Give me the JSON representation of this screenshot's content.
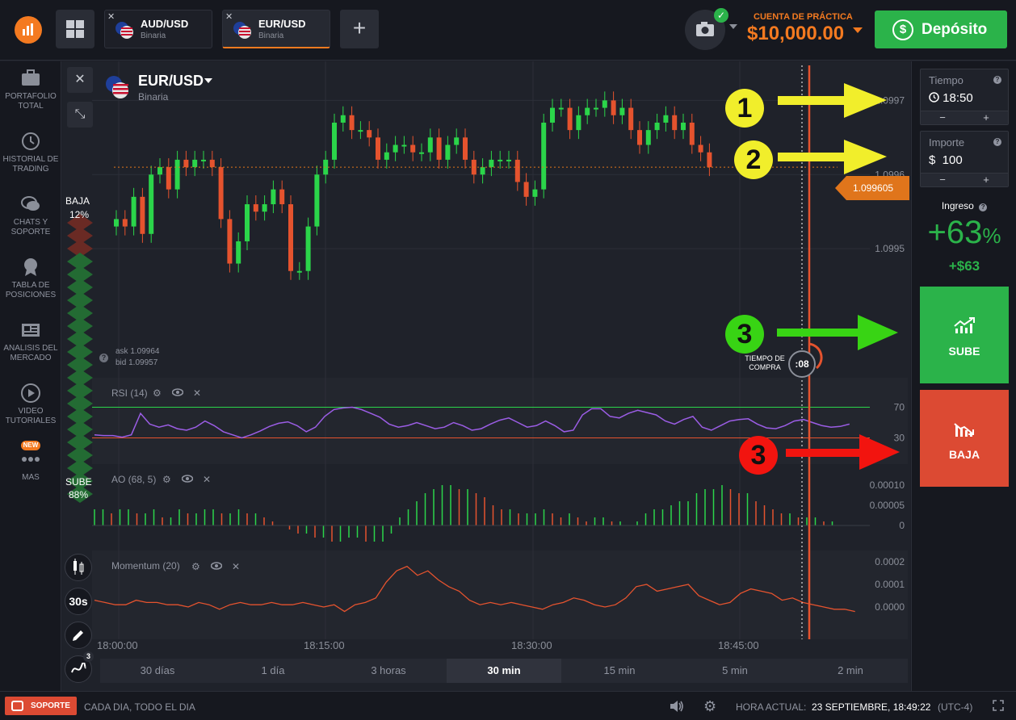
{
  "header": {
    "tabs": [
      {
        "pair": "AUD/USD",
        "type": "Binaria",
        "active": false
      },
      {
        "pair": "EUR/USD",
        "type": "Binaria",
        "active": true
      }
    ],
    "add_tab_label": "+",
    "account_label": "CUENTA DE PRÁCTICA",
    "balance": "$10,000.00",
    "deposit_label": "Depósito",
    "deposit_icon": "$",
    "close_tab_glyph": "✕",
    "camera_check": "✓"
  },
  "sidebar": {
    "items": [
      {
        "label": "PORTAFOLIO TOTAL",
        "icon": "briefcase-icon"
      },
      {
        "label": "HISTORIAL DE TRADING",
        "icon": "history-icon"
      },
      {
        "label": "CHATS Y SOPORTE",
        "icon": "chat-icon"
      },
      {
        "label": "TABLA DE POSICIONES",
        "icon": "medal-icon"
      },
      {
        "label": "ANALISIS DEL MERCADO",
        "icon": "newspaper-icon"
      },
      {
        "label": "VIDEO TUTORIALES",
        "icon": "play-icon"
      },
      {
        "label": "MAS",
        "icon": "dots-icon",
        "badge": "NEW"
      }
    ]
  },
  "chart": {
    "asset_name": "EUR/USD",
    "asset_type": "Binaria",
    "close_glyph": "✕",
    "shrink_glyph": "⤡",
    "help_glyph": "?",
    "sentiment": {
      "down_label": "BAJA",
      "down_pct": "12%",
      "up_label": "SUBE",
      "up_pct": "88%"
    },
    "current_price": "1.099605",
    "ask": "ask 1.09964",
    "bid": "bid 1.09957",
    "purchase_time_label": "TIEMPO DE COMPRA",
    "countdown": ":08",
    "indicators": [
      {
        "label": "RSI (14)"
      },
      {
        "label": "AO (68, 5)"
      },
      {
        "label": "Momentum (20)"
      }
    ],
    "tools": [
      {
        "label": "",
        "icon": "candles-icon"
      },
      {
        "label": "30s",
        "icon": ""
      },
      {
        "label": "",
        "icon": "pencil-icon"
      },
      {
        "label": "",
        "icon": "indicators-icon",
        "badge": "3"
      }
    ],
    "ranges": [
      "30 días",
      "1 día",
      "3 horas",
      "30 min",
      "15 min",
      "5 min",
      "2 min"
    ],
    "active_range": "30 min",
    "annotation_numbers": [
      "1",
      "2",
      "3",
      "3"
    ]
  },
  "chart_data": {
    "type": "candlestick",
    "x_ticks": [
      "18:00:00",
      "18:15:00",
      "18:30:00",
      "18:45:00"
    ],
    "price_ticks": [
      1.0997,
      1.0996,
      1.0995
    ],
    "price_tick_labels": [
      "1.0997",
      "1.0996",
      "1.0995"
    ],
    "ylim": [
      1.09935,
      1.09972
    ],
    "rsi": {
      "levels": [
        70,
        30
      ],
      "level_labels": [
        "70",
        "30"
      ]
    },
    "ao": {
      "ticks": [
        "0.00010",
        "0.00005",
        "0"
      ]
    },
    "momentum": {
      "ticks": [
        "0.0002",
        "0.0001",
        "0.0000"
      ]
    },
    "colors": {
      "up": "#2bd54a",
      "down": "#e5532e",
      "rsi": "#9b5de5",
      "momentum": "#e5532e"
    }
  },
  "trade": {
    "time_label": "Tiempo",
    "time_value": "18:50",
    "amount_label": "Importe",
    "amount_value": "$  100",
    "minus": "−",
    "plus": "+",
    "help_glyph": "?",
    "payout_label": "Ingreso",
    "payout_pct": "+63",
    "payout_pct_sign": "%",
    "profit": "+$63",
    "call_label": "SUBE",
    "put_label": "BAJA"
  },
  "footer": {
    "support_label": "SOPORTE",
    "tagline": "CADA DIA, TODO EL DIA",
    "settings_glyph": "⚙",
    "clock_label": "HORA ACTUAL:",
    "clock_value": "23 SEPTIEMBRE, 18:49:22",
    "timezone": "(UTC-4)"
  },
  "colors": {
    "accent": "#f47a20",
    "green": "#2bb34a",
    "red": "#dc4a33",
    "background": "#1d1f27"
  }
}
